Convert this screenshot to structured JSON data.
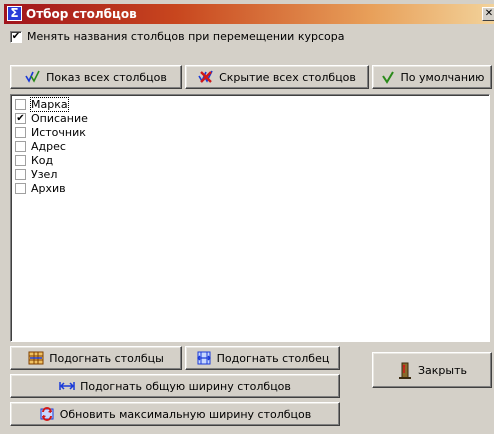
{
  "window": {
    "title": "Отбор столбцов",
    "app_icon_glyph": "Σ",
    "close_glyph": "✕"
  },
  "options": {
    "rename_on_cursor_move": {
      "label": "Менять названия столбцов при перемещении курсора",
      "checked": true
    }
  },
  "toolbar": {
    "show_all_label": "Показ всех столбцов",
    "hide_all_label": "Скрытие всех столбцов",
    "default_label": "По умолчанию"
  },
  "columns": [
    {
      "label": "Марка",
      "checked": false
    },
    {
      "label": "Описание",
      "checked": true
    },
    {
      "label": "Источник",
      "checked": false
    },
    {
      "label": "Адрес",
      "checked": false
    },
    {
      "label": "Код",
      "checked": false
    },
    {
      "label": "Узел",
      "checked": false
    },
    {
      "label": "Архив",
      "checked": false
    }
  ],
  "actions": {
    "fit_columns_label": "Подогнать столбцы",
    "fit_column_label": "Подогнать столбец",
    "fit_total_width_label": "Подогнать общую ширину столбцов",
    "refresh_max_width_label": "Обновить максимальную ширину столбцов",
    "close_label": "Закрыть"
  },
  "colors": {
    "face": "#d4d0c8",
    "title_start": "#a0141c",
    "title_end": "#f2d29a",
    "check_icon": "#2a8a1a",
    "show_icon": "#1a3ad8",
    "hide_icon": "#d01818"
  }
}
